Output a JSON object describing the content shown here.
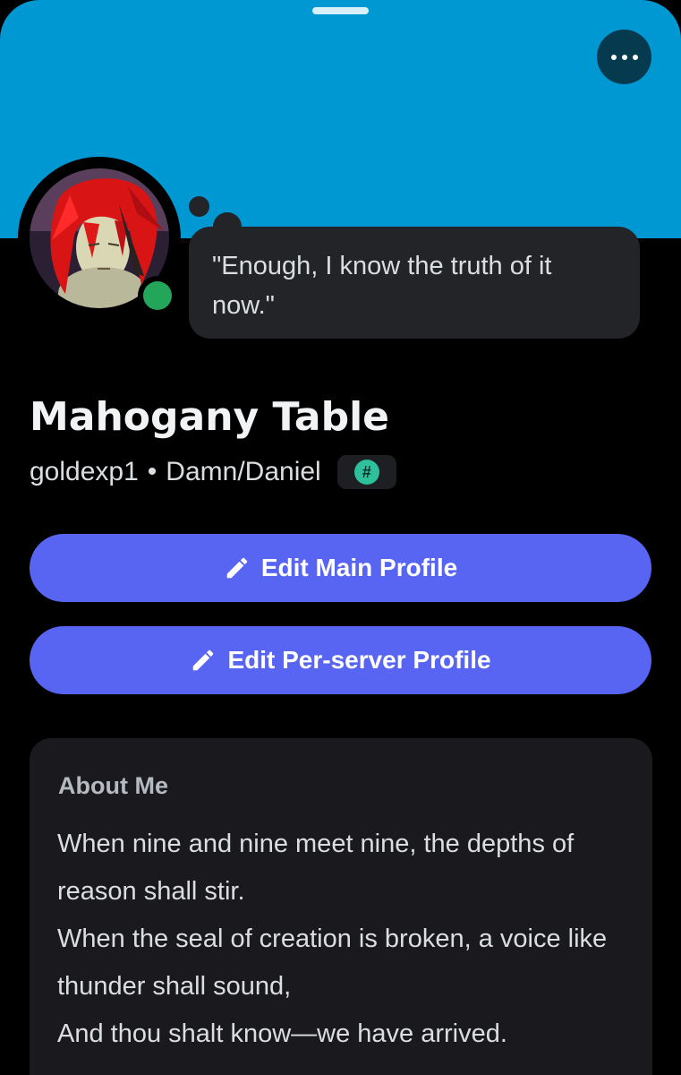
{
  "colors": {
    "banner": "#0098d3",
    "accent_button": "#5865f2",
    "status_online": "#23a55a",
    "badge_icon": "#2dc09a",
    "background": "#000000",
    "card": "#1a1a1e"
  },
  "profile": {
    "custom_status": "\"Enough, I know the truth of it now.\"",
    "display_name": "Mahogany Table",
    "username": "goldexp1",
    "separator": "•",
    "pronouns": "Damn/Daniel",
    "badge_symbol": "#",
    "status": "online"
  },
  "actions": {
    "edit_main_profile": "Edit Main Profile",
    "edit_per_server_profile": "Edit Per-server Profile"
  },
  "about": {
    "title": "About Me",
    "lines": [
      "When nine and nine meet nine, the depths of reason shall stir.",
      "When the seal of creation is broken, a voice like thunder shall sound,",
      "And thou shalt know—we have arrived."
    ]
  },
  "icons": {
    "more": "more-horizontal-icon",
    "edit": "pencil-icon",
    "badge": "hashtag-badge-icon"
  }
}
